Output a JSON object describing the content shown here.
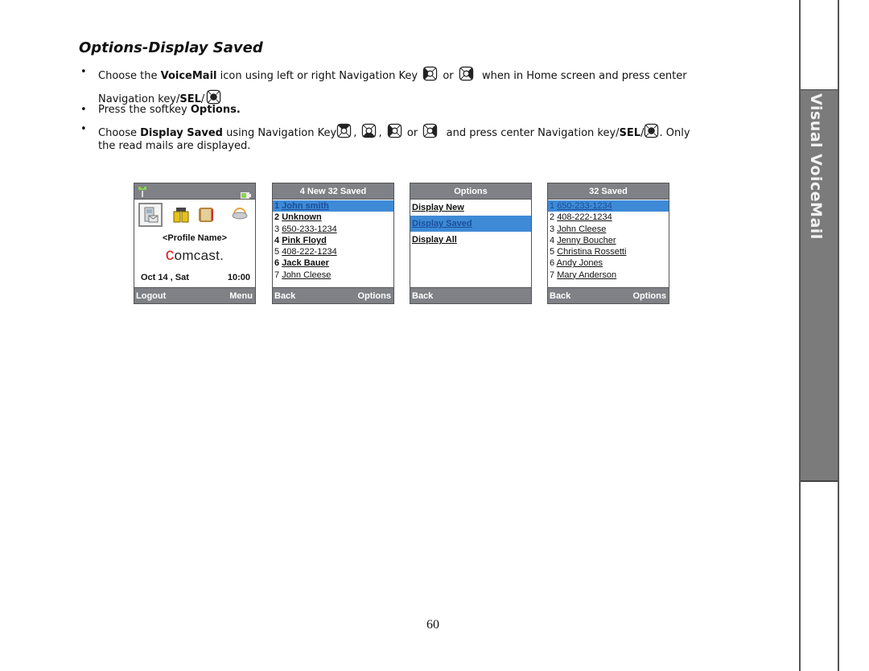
{
  "page": {
    "title": "Options-Display Saved",
    "page_number": "60",
    "side_tab_label": "Visual VoiceMail"
  },
  "instructions": {
    "bullet_glyph": "•",
    "step1": {
      "pre": "Choose the ",
      "bold": "VoiceMail",
      "mid": " icon using left or right Navigation Key ",
      "or": " or ",
      "post": " when in Home screen and press center",
      "line2_pre": "Navigation key/",
      "line2_bold": "SEL",
      "line2_slash": "/"
    },
    "step2": {
      "pre": "Press the softkey ",
      "bold": "Options."
    },
    "step3": {
      "pre": "Choose ",
      "bold": "Display Saved",
      "mid": " using Navigation Key",
      "comma": ",",
      "or": " or ",
      "post": " and press center Navigation key/",
      "bold2": "SEL",
      "slash": "/",
      "end": ". Only",
      "line2": "the read mails are displayed."
    },
    "icons": [
      "nav-left-key-icon",
      "nav-right-key-icon",
      "nav-center-key-icon",
      "nav-up-key-icon",
      "nav-down-key-icon"
    ]
  },
  "screens": {
    "home": {
      "icons": [
        "signal-icon",
        "battery-icon",
        "voicemail-icon",
        "phonebook-icon",
        "notebook-icon",
        "weather-icon"
      ],
      "profile": "<Profile Name>",
      "logo_c": "c",
      "logo_rest": "omcast.",
      "date": "Oct 14 , Sat",
      "time": "10:00",
      "left_soft": "Logout",
      "right_soft": "Menu"
    },
    "inbox": {
      "header": "4 New 32 Saved",
      "rows": [
        {
          "num": "1",
          "text": "John smith",
          "selected": true,
          "bold": true
        },
        {
          "num": "2",
          "text": "Unknown",
          "selected": false,
          "bold": true
        },
        {
          "num": "3",
          "text": "650-233-1234",
          "selected": false,
          "bold": false
        },
        {
          "num": "4",
          "text": "Pink Floyd",
          "selected": false,
          "bold": true
        },
        {
          "num": "5",
          "text": "408-222-1234",
          "selected": false,
          "bold": false
        },
        {
          "num": "6",
          "text": "Jack Bauer",
          "selected": false,
          "bold": true
        },
        {
          "num": "7",
          "text": "John Cleese",
          "selected": false,
          "bold": false
        }
      ],
      "left_soft": "Back",
      "right_soft": "Options"
    },
    "options": {
      "header": "Options",
      "items": [
        {
          "text": "Display New",
          "selected": false
        },
        {
          "text": "Display Saved",
          "selected": true
        },
        {
          "text": "Display All",
          "selected": false
        }
      ],
      "left_soft": "Back"
    },
    "saved": {
      "header": "32 Saved",
      "rows": [
        {
          "num": "1",
          "text": "650-233-1234",
          "selected": true
        },
        {
          "num": "2",
          "text": "408-222-1234",
          "selected": false
        },
        {
          "num": "3",
          "text": "John Cleese",
          "selected": false
        },
        {
          "num": "4",
          "text": "Jenny Boucher",
          "selected": false
        },
        {
          "num": "5",
          "text": "Christina Rossetti",
          "selected": false
        },
        {
          "num": "6",
          "text": "Andy Jones",
          "selected": false
        },
        {
          "num": "7",
          "text": "Mary Anderson",
          "selected": false
        }
      ],
      "left_soft": "Back",
      "right_soft": "Options"
    }
  }
}
